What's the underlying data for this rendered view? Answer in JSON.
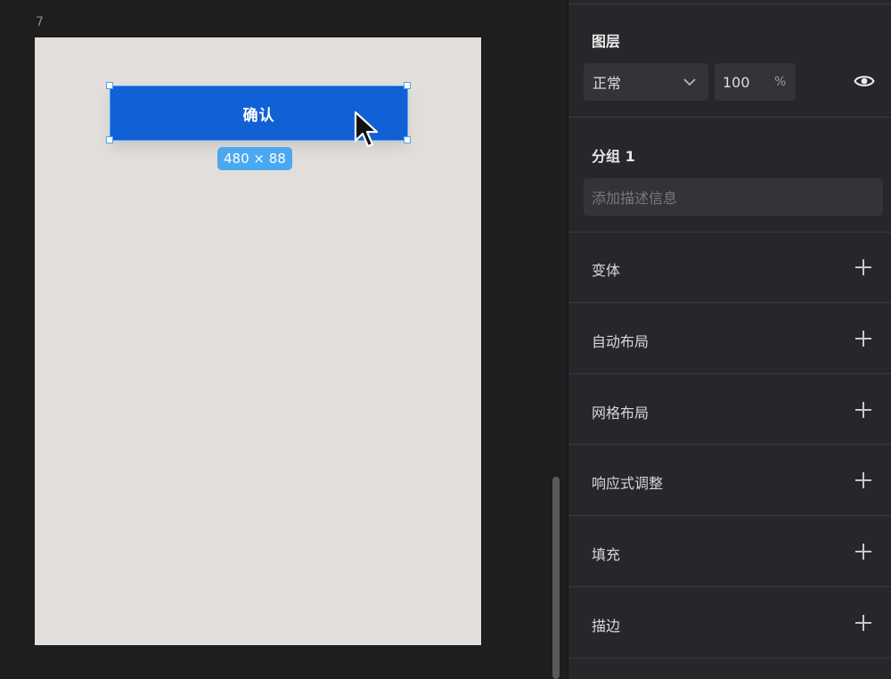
{
  "canvas": {
    "frame_label": "7",
    "button_text": "确认",
    "size_badge": "480 × 88"
  },
  "panel": {
    "layer": {
      "title": "图层",
      "blend_mode": "正常",
      "opacity_value": "100",
      "opacity_unit": "%",
      "visibility_icon": "eye-icon"
    },
    "group": {
      "title": "分组 1",
      "description_placeholder": "添加描述信息"
    },
    "sections": [
      {
        "label": "变体",
        "icon": "plus-icon"
      },
      {
        "label": "自动布局",
        "icon": "plus-icon"
      },
      {
        "label": "网格布局",
        "icon": "plus-icon"
      },
      {
        "label": "响应式调整",
        "icon": "plus-icon"
      },
      {
        "label": "填充",
        "icon": "plus-icon"
      },
      {
        "label": "描边",
        "icon": "plus-icon"
      }
    ]
  },
  "colors": {
    "button_fill": "#1160d6",
    "selection": "#4aa6f0",
    "artboard": "#e2dedb",
    "panel_bg": "#26272b"
  }
}
